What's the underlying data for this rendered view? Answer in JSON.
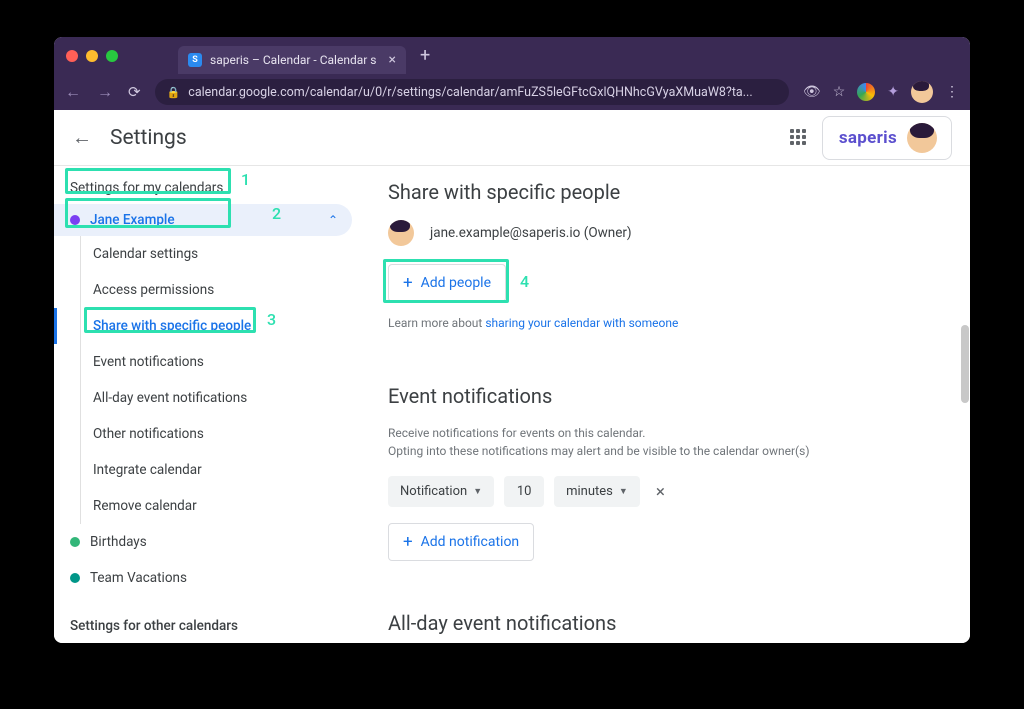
{
  "browser": {
    "tab_title": "saperis – Calendar - Calendar s",
    "url_display": "calendar.google.com/calendar/u/0/r/settings/calendar/amFuZS5leGFtcGxlQHNhcGVyaXMuaW8?ta..."
  },
  "header": {
    "settings_title": "Settings",
    "brand": "saperis"
  },
  "sidebar": {
    "section_label": "Settings for my calendars",
    "active_calendar": "Jane Example",
    "items": [
      "Calendar settings",
      "Access permissions",
      "Share with specific people",
      "Event notifications",
      "All-day event notifications",
      "Other notifications",
      "Integrate calendar",
      "Remove calendar"
    ],
    "other_calendars": [
      {
        "name": "Birthdays",
        "color": "#33b679"
      },
      {
        "name": "Team Vacations",
        "color": "#009688"
      }
    ],
    "bottom_section": "Settings for other calendars"
  },
  "annotations": {
    "n1": "1",
    "n2": "2",
    "n3": "3",
    "n4": "4"
  },
  "main": {
    "share": {
      "title": "Share with specific people",
      "owner_email": "jane.example@saperis.io (Owner)",
      "add_people": "Add people",
      "learn_prefix": "Learn more about ",
      "learn_link": "sharing your calendar with someone"
    },
    "event_notifications": {
      "title": "Event notifications",
      "desc_line1": "Receive notifications for events on this calendar.",
      "desc_line2": "Opting into these notifications may alert and be visible to the calendar owner(s)",
      "type": "Notification",
      "value": "10",
      "unit": "minutes",
      "add_label": "Add notification"
    },
    "allday": {
      "title": "All-day event notifications"
    }
  }
}
